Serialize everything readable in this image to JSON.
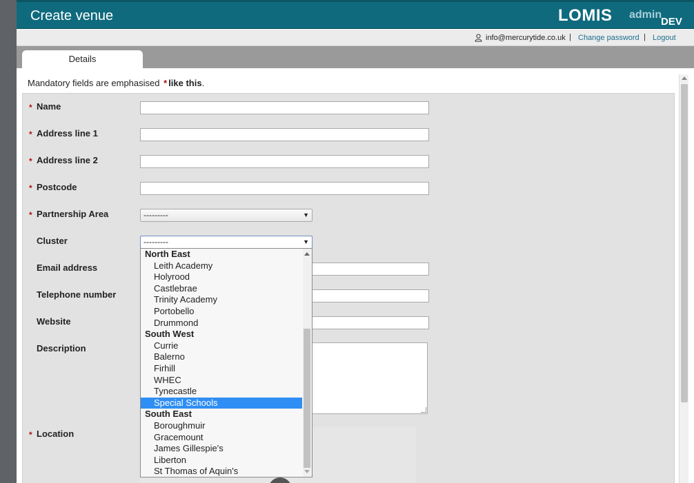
{
  "header": {
    "title": "Create venue",
    "brand": "LOMIS",
    "role": "admin",
    "env": "DEV"
  },
  "userbar": {
    "email": "info@mercurytide.co.uk",
    "change_password": "Change password",
    "logout": "Logout"
  },
  "tabs": [
    {
      "label": "Details"
    }
  ],
  "mandatory": {
    "text": "Mandatory fields are emphasised",
    "marker": "*",
    "example": "like this",
    "end": "."
  },
  "form": {
    "required_marker": "*",
    "name_label": "Name",
    "address1_label": "Address line 1",
    "address2_label": "Address line 2",
    "postcode_label": "Postcode",
    "partnership_label": "Partnership Area",
    "partnership_value": "---------",
    "cluster_label": "Cluster",
    "cluster_value": "---------",
    "email_label": "Email address",
    "telephone_label": "Telephone number",
    "website_label": "Website",
    "description_label": "Description",
    "location_label": "Location"
  },
  "cluster_options": [
    {
      "type": "group",
      "label": "North East"
    },
    {
      "type": "item",
      "label": "Leith Academy"
    },
    {
      "type": "item",
      "label": "Holyrood"
    },
    {
      "type": "item",
      "label": "Castlebrae"
    },
    {
      "type": "item",
      "label": "Trinity Academy"
    },
    {
      "type": "item",
      "label": "Portobello"
    },
    {
      "type": "item",
      "label": "Drummond"
    },
    {
      "type": "group",
      "label": "South West"
    },
    {
      "type": "item",
      "label": "Currie"
    },
    {
      "type": "item",
      "label": "Balerno"
    },
    {
      "type": "item",
      "label": "Firhill"
    },
    {
      "type": "item",
      "label": "WHEC"
    },
    {
      "type": "item",
      "label": "Tynecastle"
    },
    {
      "type": "item",
      "label": "Special Schools",
      "selected": true
    },
    {
      "type": "group",
      "label": "South East"
    },
    {
      "type": "item",
      "label": "Boroughmuir"
    },
    {
      "type": "item",
      "label": "Gracemount"
    },
    {
      "type": "item",
      "label": "James Gillespie's"
    },
    {
      "type": "item",
      "label": "Liberton"
    },
    {
      "type": "item",
      "label": "St Thomas of Aquin's"
    }
  ],
  "colors": {
    "header_bg": "#0f6a7d",
    "selected_option": "#2f8ef3",
    "required": "#b01010"
  }
}
